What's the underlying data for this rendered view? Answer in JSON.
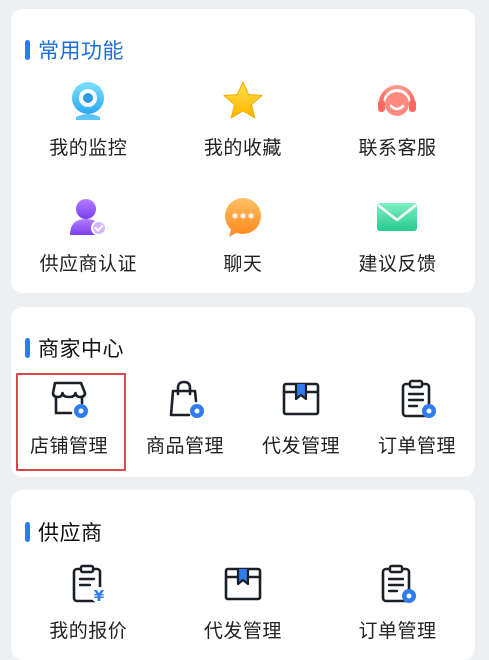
{
  "sections": {
    "common": {
      "title": "常用功能",
      "items": [
        {
          "label": "我的监控",
          "icon": "camera-icon"
        },
        {
          "label": "我的收藏",
          "icon": "star-icon"
        },
        {
          "label": "联系客服",
          "icon": "headset-icon"
        },
        {
          "label": "供应商认证",
          "icon": "user-verify-icon"
        },
        {
          "label": "聊天",
          "icon": "chat-icon"
        },
        {
          "label": "建议反馈",
          "icon": "mail-icon"
        }
      ]
    },
    "merchant": {
      "title": "商家中心",
      "items": [
        {
          "label": "店铺管理",
          "icon": "store-settings-icon"
        },
        {
          "label": "商品管理",
          "icon": "bag-settings-icon"
        },
        {
          "label": "代发管理",
          "icon": "box-icon"
        },
        {
          "label": "订单管理",
          "icon": "clipboard-settings-icon"
        }
      ]
    },
    "supplier": {
      "title": "供应商",
      "items": [
        {
          "label": "我的报价",
          "icon": "quote-icon"
        },
        {
          "label": "代发管理",
          "icon": "box-icon"
        },
        {
          "label": "订单管理",
          "icon": "clipboard-settings-icon"
        }
      ]
    }
  },
  "colors": {
    "accent": "#2f7bf0",
    "highlight_border": "#d9474c",
    "background": "#eeeff2"
  }
}
